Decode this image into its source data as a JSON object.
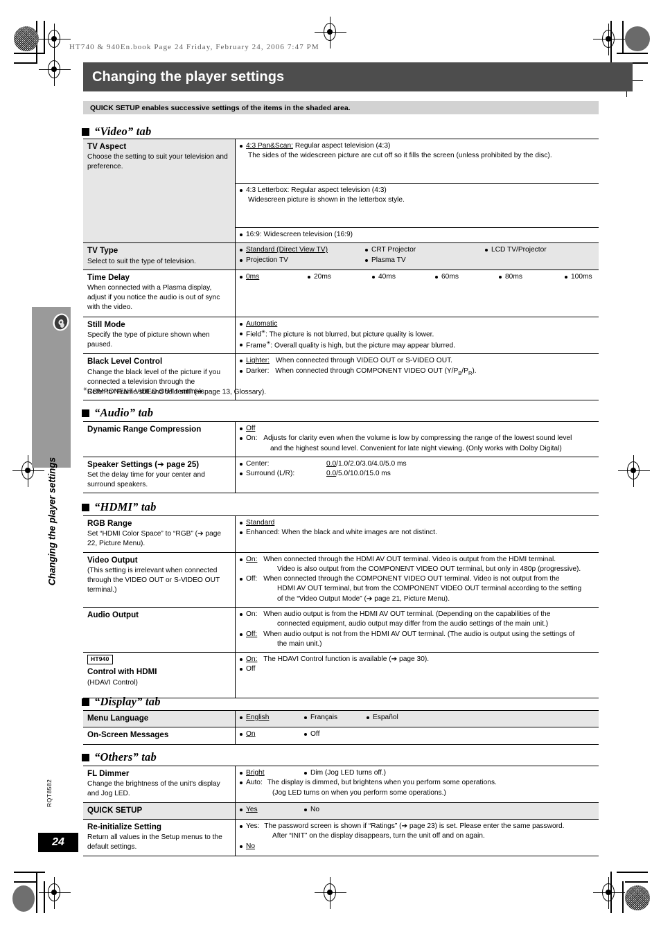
{
  "page": {
    "header_line": "HT740 & 940En.book  Page 24  Friday, February 24, 2006  7:47 PM",
    "title": "Changing the player settings",
    "quick_setup_note": "QUICK SETUP enables successive settings of the items in the shaded area.",
    "side_title": "Changing the player settings",
    "rqt_code": "RQT8582",
    "page_number": "24"
  },
  "sections": {
    "video": {
      "heading": "“Video” tab"
    },
    "audio": {
      "heading": "“Audio” tab"
    },
    "hdmi": {
      "heading": "“HDMI” tab"
    },
    "display": {
      "heading": "“Display” tab"
    },
    "others": {
      "heading": "“Others” tab"
    }
  },
  "video": {
    "tv_aspect": {
      "name": "TV Aspect",
      "desc": "Choose the setting to suit your television and preference.",
      "opt1_label": "4:3 Pan&Scan:",
      "opt1_value": "Regular aspect television (4:3)",
      "opt1_cont": "The sides of the widescreen picture are cut off so it fills the screen (unless prohibited by the disc).",
      "opt2_label": "4:3 Letterbox:",
      "opt2_value": "Regular aspect television (4:3)",
      "opt2_cont": "Widescreen picture is shown in the letterbox style.",
      "opt3_label": "16:9:",
      "opt3_value": "Widescreen television (16:9)"
    },
    "tv_type": {
      "name": "TV Type",
      "desc": "Select to suit the type of television.",
      "options": [
        "Standard (Direct View TV)",
        "CRT Projector",
        "LCD TV/Projector",
        "Projection TV",
        "Plasma TV"
      ]
    },
    "time_delay": {
      "name": "Time Delay",
      "desc": "When connected with a Plasma display, adjust if you notice the audio is out of sync with the video.",
      "options": [
        "0ms",
        "20ms",
        "40ms",
        "60ms",
        "80ms",
        "100ms"
      ]
    },
    "still_mode": {
      "name": "Still Mode",
      "desc": "Specify the type of picture shown when paused.",
      "opt1": "Automatic",
      "opt2_label": "Field",
      "opt2_text": ":    The picture is not blurred, but picture quality is lower.",
      "opt3_label": "Frame",
      "opt3_text": ": Overall quality is high, but the picture may appear blurred."
    },
    "black_level": {
      "name": "Black Level Control",
      "desc": "Change the black level of the picture if you connected a television through the COMPONENT VIDEO OUT terminals.",
      "opt1_label": "Lighter:",
      "opt1_text": "When connected through VIDEO OUT or S-VIDEO OUT.",
      "opt2_label": "Darker:",
      "opt2_text_a": "When connected through COMPONENT VIDEO OUT (Y/P",
      "opt2_sub_b": "B",
      "opt2_text_b": "/P",
      "opt2_sub_r": "R",
      "opt2_text_c": ")."
    },
    "footnote": "Refer to “Frame still and field still” (➔ page 13, Glossary)."
  },
  "audio": {
    "drc": {
      "name": "Dynamic Range Compression",
      "opt1": "Off",
      "opt2_label": "On:",
      "opt2_text": "Adjusts for clarity even when the volume is low by compressing the range of the lowest sound level",
      "opt2_cont": "and the highest sound level. Convenient for late night viewing. (Only works with Dolby Digital)"
    },
    "speaker": {
      "name": "Speaker Settings (➔ page 25)",
      "desc": "Set the delay time for your center and surround speakers.",
      "opt1_label": "Center:",
      "opt1_u": "0.0",
      "opt1_rest": "/1.0/2.0/3.0/4.0/5.0 ms",
      "opt2_label": "Surround (L/R):",
      "opt2_u": "0.0",
      "opt2_rest": "/5.0/10.0/15.0 ms"
    }
  },
  "hdmi": {
    "rgb_range": {
      "name": "RGB Range",
      "desc": "Set “HDMI Color Space” to “RGB” (➔ page 22, Picture Menu).",
      "opt1": "Standard",
      "opt2": "Enhanced: When the black and white images are not distinct."
    },
    "video_output": {
      "name": "Video Output",
      "desc": "(This setting is irrelevant when connected through the VIDEO OUT or S-VIDEO OUT terminal.)",
      "opt1_label": "On:",
      "opt1_text": "When connected through the HDMI AV OUT terminal. Video is output from the HDMI terminal.",
      "opt1_cont": "Video is also output from the COMPONENT VIDEO OUT terminal, but only in 480p (progressive).",
      "opt2_label": "Off:",
      "opt2_text": "When connected through the COMPONENT VIDEO OUT terminal. Video is not output from the",
      "opt2_cont1": "HDMI AV OUT terminal, but from the COMPONENT VIDEO OUT terminal according to the setting",
      "opt2_cont2": "of the “Video Output Mode” (➔ page 21, Picture Menu)."
    },
    "audio_output": {
      "name": "Audio Output",
      "opt1_label": "On:",
      "opt1_text": "When audio output is from the HDMI AV OUT terminal. (Depending on the capabilities of the",
      "opt1_cont": "connected equipment, audio output may differ from the audio settings of the main unit.)",
      "opt2_label": "Off:",
      "opt2_text": "When audio output is not from the HDMI AV OUT terminal. (The audio is output using the settings of",
      "opt2_cont": "the main unit.)"
    },
    "control_hdmi": {
      "badge": "HT940",
      "name": "Control with HDMI",
      "desc": "(HDAVI Control)",
      "opt1_label": "On:",
      "opt1_text": "The HDAVI Control function is available (➔ page 30).",
      "opt2": "Off"
    }
  },
  "display": {
    "menu_language": {
      "name": "Menu Language",
      "options": [
        "English",
        "Français",
        "Español"
      ]
    },
    "onscreen": {
      "name": "On-Screen Messages",
      "options": [
        "On",
        "Off"
      ]
    }
  },
  "others": {
    "fl_dimmer": {
      "name": "FL Dimmer",
      "desc": "Change the brightness of the unit's display and Jog LED.",
      "opt1": "Bright",
      "opt2": "Dim (Jog LED turns off.)",
      "opt3_label": "Auto:",
      "opt3_text": "The display is dimmed, but brightens when you perform some operations.",
      "opt3_cont": "(Jog LED turns on when you perform some operations.)"
    },
    "quick_setup": {
      "name": "QUICK SETUP",
      "options": [
        "Yes",
        "No"
      ]
    },
    "reinit": {
      "name": "Re-initialize Setting",
      "desc": "Return all values in the Setup menus to the default settings.",
      "opt1_label": "Yes:",
      "opt1_text": "The password screen is shown if “Ratings” (➔ page 23) is set. Please enter the same password.",
      "opt1_cont": "After “INIT” on the display disappears, turn the unit off and on again.",
      "opt2": "No"
    }
  }
}
